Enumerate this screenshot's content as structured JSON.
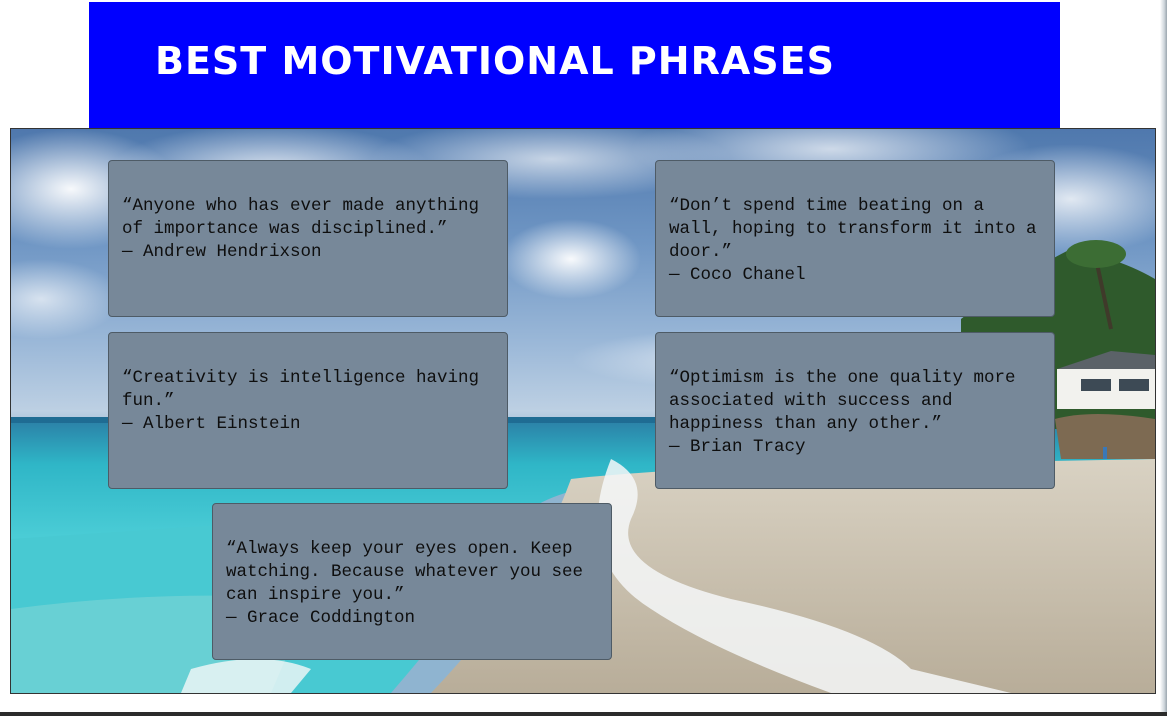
{
  "header": {
    "title": "BEST MOTIVATIONAL PHRASES",
    "banner_color": "#0000ff",
    "title_color": "#ffffff"
  },
  "background": {
    "icon": "beach-photo"
  },
  "quotes": [
    {
      "text": "“Anyone who has ever made anything of importance was disciplined.”",
      "author": "— Andrew Hendrixson"
    },
    {
      "text": "“Don’t spend time beating on a wall, hoping to transform it into a door.”",
      "author": "— Coco Chanel"
    },
    {
      "text": "“Creativity is intelligence having fun.”",
      "author": "— Albert Einstein"
    },
    {
      "text": "“Optimism is the one quality more associated with success and happiness than any other.”",
      "author": "— Brian Tracy"
    },
    {
      "text": "“Always keep your eyes open. Keep watching. Because whatever you see can inspire you.”",
      "author": "— Grace Coddington"
    }
  ],
  "card_style": {
    "background": "#778899",
    "text_color": "#0e0e0e"
  }
}
